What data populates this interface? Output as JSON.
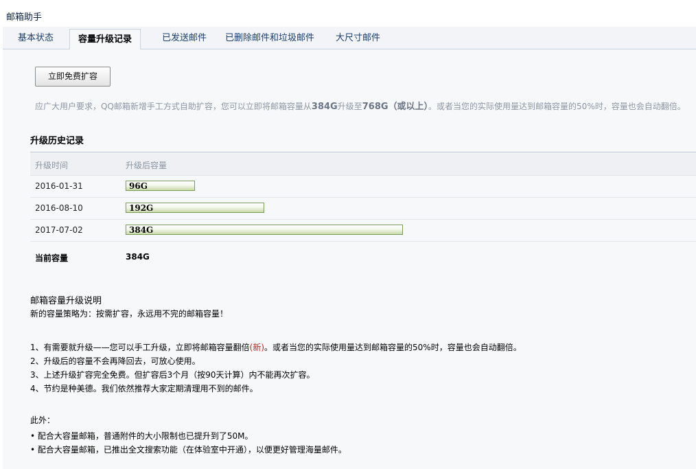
{
  "app": {
    "title": "邮箱助手"
  },
  "tabs": [
    {
      "label": "基本状态",
      "active": false
    },
    {
      "label": "容量升级记录",
      "active": true
    },
    {
      "label": "已发送邮件",
      "active": false
    },
    {
      "label": "已删除邮件和垃圾邮件",
      "active": false
    },
    {
      "label": "大尺寸邮件",
      "active": false
    }
  ],
  "expand_button": {
    "label": "立即免费扩容"
  },
  "notice": {
    "text_before": "应广大用户要求，QQ邮箱新增手工方式自助扩容，您可以立即将邮箱容量从",
    "from": "384G",
    "mid": "升级至",
    "to": "768G（或以上）",
    "text_after": "。或者当您的实际使用量达到邮箱容量的50%时，容量也会自动翻倍。"
  },
  "history": {
    "title": "升级历史记录",
    "headers": {
      "time": "升级时间",
      "capacity": "升级后容量"
    },
    "rows": [
      {
        "date": "2016-01-31",
        "capacity": "96G",
        "fill": 0.25
      },
      {
        "date": "2016-08-10",
        "capacity": "192G",
        "fill": 0.5
      },
      {
        "date": "2017-07-02",
        "capacity": "384G",
        "fill": 1.0
      }
    ],
    "current_label": "当前容量",
    "current_value": "384G"
  },
  "explain": {
    "title": "邮箱容量升级说明",
    "subtitle": "新的容量策略为：按需扩容，永远用不完的邮箱容量！",
    "rule1_a": "1、有需要就升级——您可以手工升级，立即将邮箱容量翻倍",
    "rule1_hl": "(新)",
    "rule1_b": "。或者当您的实际使用量达到邮箱容量的50%时，容量也会自动翻倍。",
    "rule2": "2、升级后的容量不会再降回去，可放心使用。",
    "rule3": "3、上述升级扩容完全免费。但扩容后3个月（按90天计算）内不能再次扩容。",
    "rule4": "4、节约是种美德。我们依然推荐大家定期清理用不到的邮件。"
  },
  "other": {
    "title": "此外：",
    "bullet1": "• 配合大容量邮箱，普通附件的大小限制也已提升到了50M。",
    "bullet2": "• 配合大容量邮箱，已推出全文搜索功能（在体验室中开通），以便更好管理海量邮件。"
  }
}
